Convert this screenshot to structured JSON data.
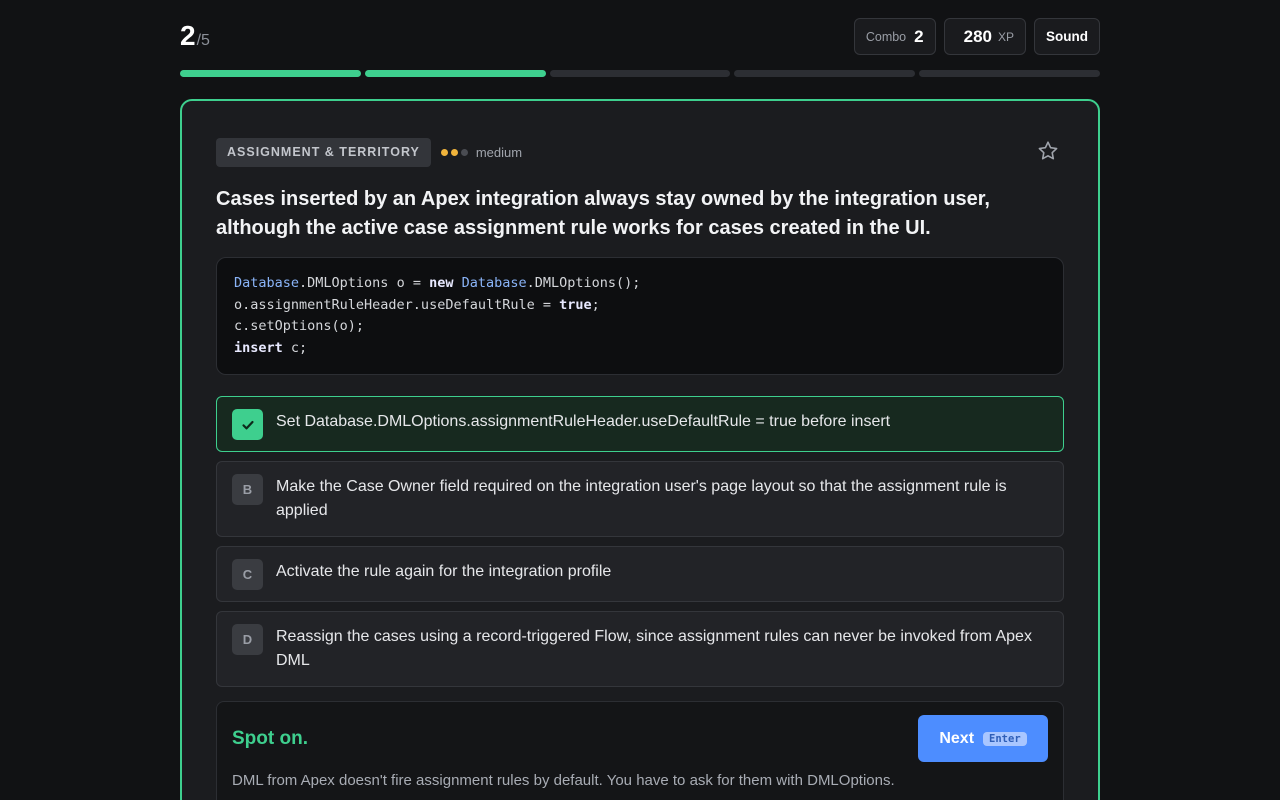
{
  "header": {
    "current": "2",
    "total": "/5",
    "combo_label": "Combo",
    "combo_value": "2",
    "xp_value": "280",
    "xp_label": "XP",
    "sound_label": "Sound"
  },
  "progress": {
    "completed": 2,
    "total": 5,
    "color_done": "#3ecf8e",
    "color_pending": "#2c2e33"
  },
  "question": {
    "topic": "ASSIGNMENT & TERRITORY",
    "difficulty": "medium",
    "difficulty_level": 2,
    "difficulty_max": 3,
    "starred": false,
    "text": "Cases inserted by an Apex integration always stay owned by the integration user, although the active case assignment rule works for cases created in the UI.",
    "code": [
      "Database.DMLOptions o = new Database.DMLOptions();",
      "o.assignmentRuleHeader.useDefaultRule = true;",
      "c.setOptions(o);",
      "insert c;"
    ]
  },
  "options": [
    {
      "key": "A",
      "text": "Set Database.DMLOptions.assignmentRuleHeader.useDefaultRule = true before insert",
      "state": "correct"
    },
    {
      "key": "B",
      "text": "Make the Case Owner field required on the integration user's page layout so that the assignment rule is applied",
      "state": "default"
    },
    {
      "key": "C",
      "text": "Activate the rule again for the integration profile",
      "state": "default"
    },
    {
      "key": "D",
      "text": "Reassign the cases using a record-triggered Flow, since assignment rules can never be invoked from Apex DML",
      "state": "default"
    }
  ],
  "feedback": {
    "title": "Spot on.",
    "text": "DML from Apex doesn't fire assignment rules by default. You have to ask for them with DMLOptions.",
    "next_label": "Next",
    "next_key": "Enter"
  },
  "colors": {
    "accent": "#3ecf8e",
    "primary": "#4d8dff",
    "difficulty": "#f0b43c"
  }
}
